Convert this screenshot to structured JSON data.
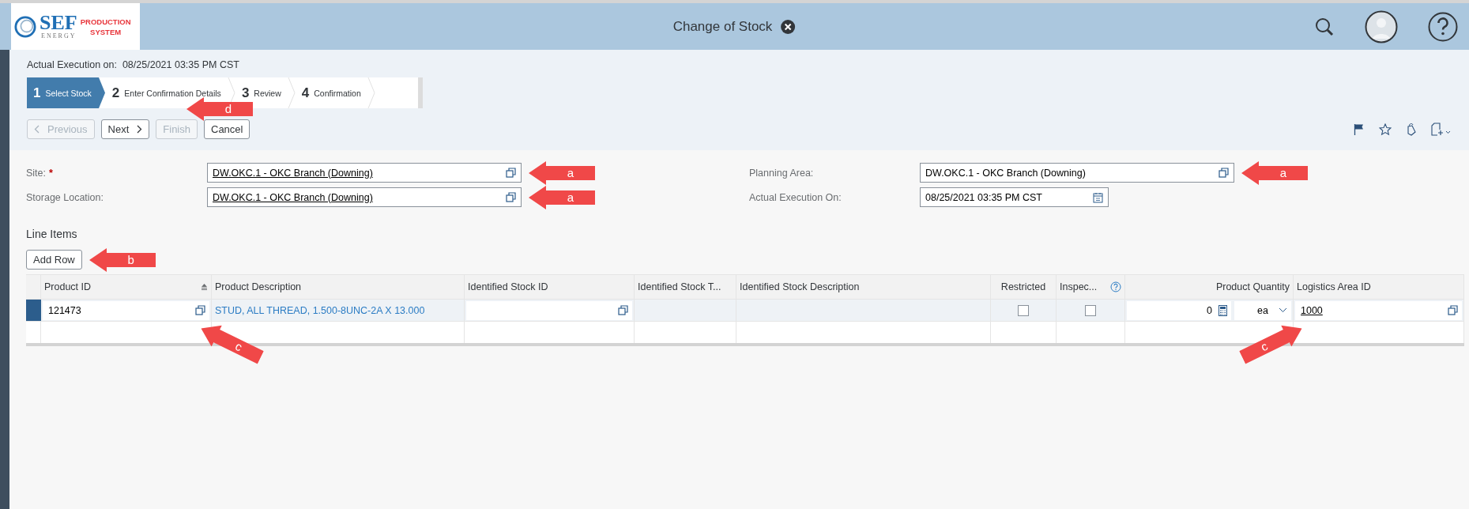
{
  "header": {
    "logo": {
      "brand": "SEF",
      "sub": "ENERGY",
      "tagline": [
        "PRODUCTION",
        "SYSTEM"
      ]
    },
    "title": "Change of Stock"
  },
  "execution_info": {
    "label": "Actual Execution on:",
    "value": "08/25/2021 03:35 PM CST"
  },
  "steps": [
    {
      "number": "1",
      "label": "Select Stock",
      "selected": true
    },
    {
      "number": "2",
      "label": "Enter Confirmation Details",
      "selected": false
    },
    {
      "number": "3",
      "label": "Review",
      "selected": false
    },
    {
      "number": "4",
      "label": "Confirmation",
      "selected": false
    }
  ],
  "buttons": [
    {
      "label": "Previous",
      "kind": "prev",
      "disabled": true
    },
    {
      "label": "Next",
      "kind": "next",
      "disabled": false
    },
    {
      "label": "Finish",
      "kind": "plain",
      "disabled": true,
      "callout": {
        "label": "d",
        "kind": "down-left"
      }
    },
    {
      "label": "Cancel",
      "kind": "plain",
      "disabled": false
    }
  ],
  "form": {
    "left": [
      {
        "label": "Site:",
        "required_mark": "*",
        "value": "DW.OKC.1 - OKC Branch (Downing)",
        "kind": "link",
        "callout": {
          "label": "a",
          "kind": "left"
        }
      },
      {
        "label": "Storage Location:",
        "value": "DW.OKC.1 - OKC Branch (Downing)",
        "kind": "link",
        "callout": {
          "label": "a",
          "kind": "left"
        }
      }
    ],
    "right": [
      {
        "label": "Planning Area:",
        "value": "DW.OKC.1 - OKC Branch (Downing)",
        "kind": "text",
        "callout": {
          "label": "a",
          "kind": "left"
        }
      },
      {
        "label": "Actual Execution On:",
        "value": "08/25/2021 03:35 PM CST",
        "kind": "date"
      }
    ]
  },
  "line_items": {
    "title": "Line Items",
    "add_row": {
      "label": "Add Row",
      "callout": {
        "label": "b",
        "kind": "left"
      }
    }
  },
  "table": {
    "columns": [
      {
        "label": "Product ID",
        "sorted": true,
        "help": false
      },
      {
        "label": "Product Description",
        "sorted": false,
        "help": false
      },
      {
        "label": "Identified Stock ID",
        "sorted": false,
        "help": false
      },
      {
        "label": "Identified Stock T...",
        "sorted": false,
        "help": false
      },
      {
        "label": "Identified Stock Description",
        "sorted": false,
        "help": false
      },
      {
        "label": "Restricted",
        "sorted": false,
        "help": false
      },
      {
        "label": "Inspec...",
        "sorted": false,
        "help": true
      },
      {
        "label": "Product Quantity",
        "sorted": false,
        "help": false
      },
      {
        "label": "Logistics Area ID",
        "sorted": false,
        "help": false
      }
    ],
    "rows": [
      {
        "selected": true,
        "product_id": "121473",
        "product_id_callout": {
          "label": "c",
          "kind": "up-left"
        },
        "product_description": "STUD, ALL THREAD, 1.500-8UNC-2A X 13.000",
        "restricted": false,
        "inspection": false,
        "quantity": "0",
        "unit": "ea",
        "logistics_area_id": "1000",
        "logistics_callout": {
          "label": "c",
          "kind": "up-right"
        }
      }
    ]
  }
}
